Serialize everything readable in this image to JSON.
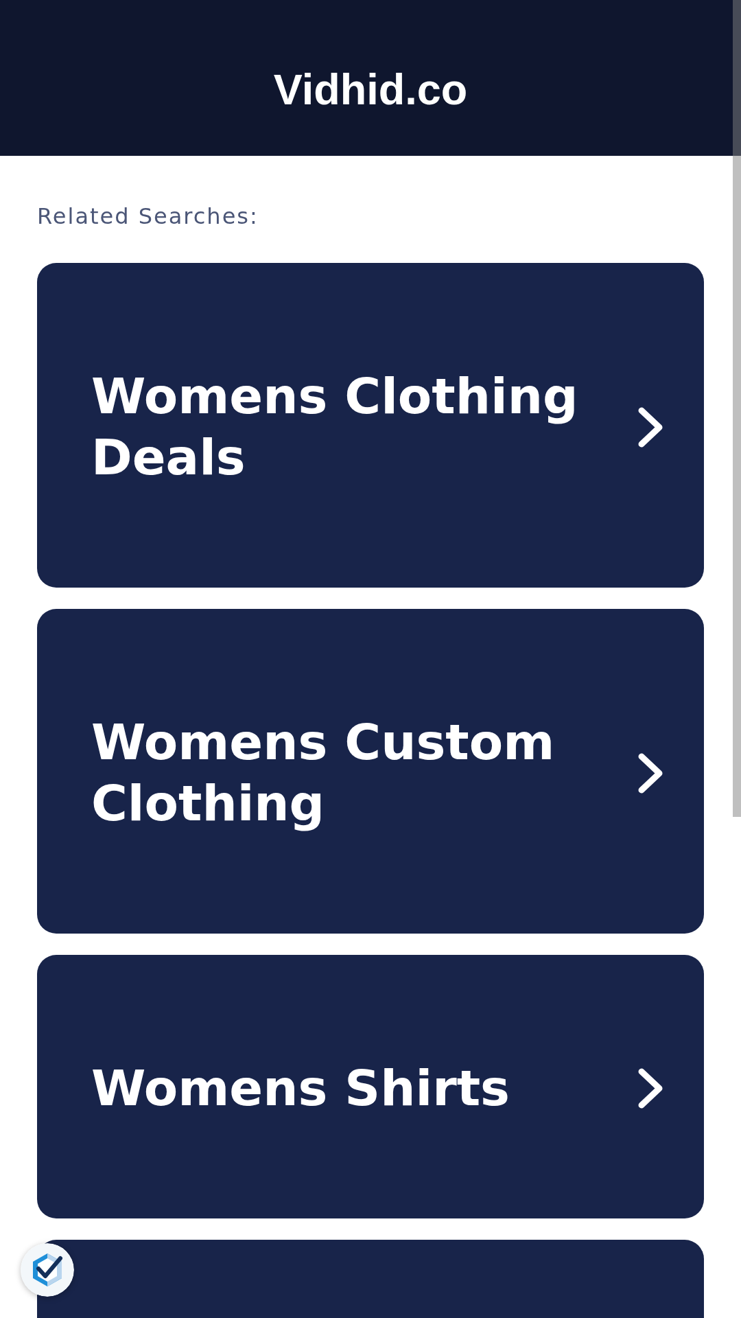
{
  "header": {
    "title": "Vidhid.co"
  },
  "related_searches": {
    "heading": "Related Searches:",
    "items": [
      {
        "kind": "link",
        "label": "Womens Clothing Deals"
      },
      {
        "kind": "link",
        "label": "Womens Custom Clothing"
      },
      {
        "kind": "link",
        "label": "Womens Shirts"
      },
      {
        "kind": "clipped"
      }
    ]
  }
}
